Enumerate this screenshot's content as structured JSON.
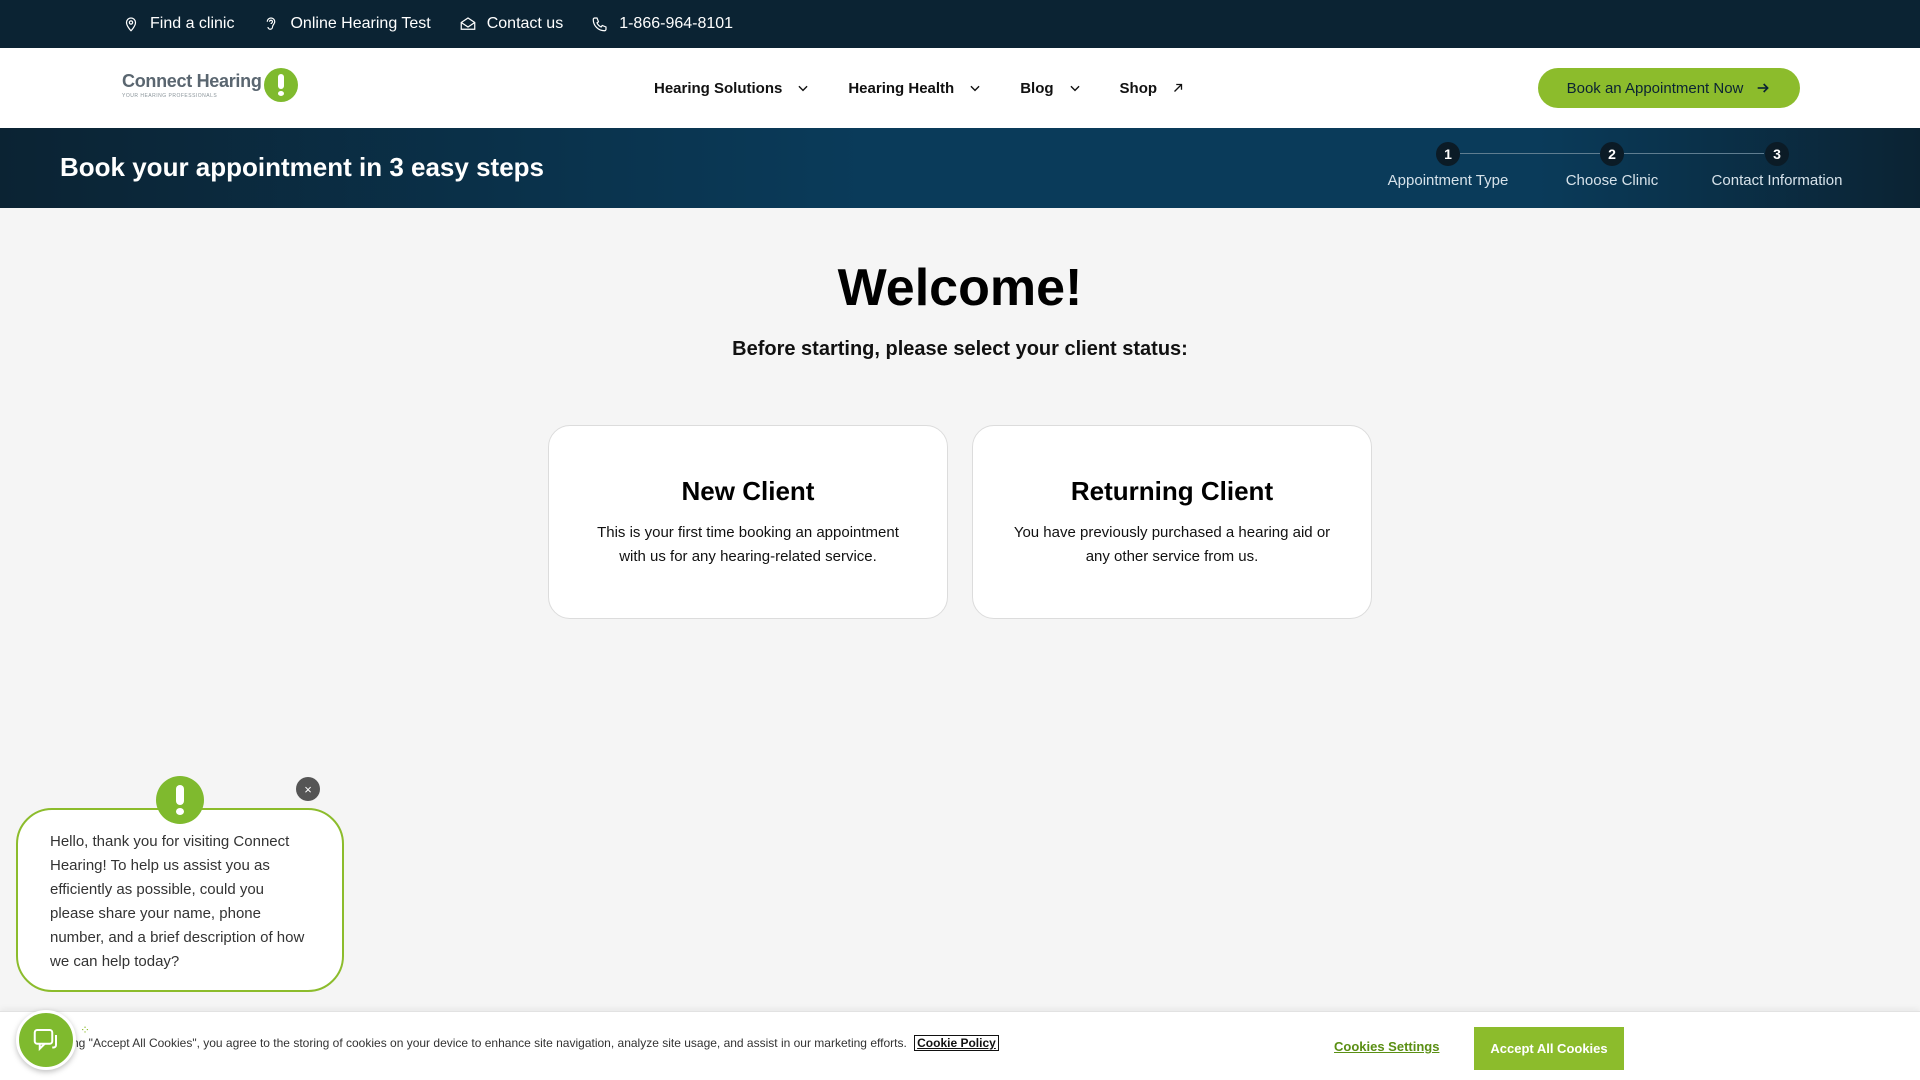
{
  "utility_bar": {
    "items": [
      {
        "label": "Find a clinic",
        "icon": "location-pin-icon"
      },
      {
        "label": "Online Hearing Test",
        "icon": "ear-icon"
      },
      {
        "label": "Contact us",
        "icon": "envelope-icon"
      },
      {
        "label": "1-866-964-8101",
        "icon": "phone-icon"
      }
    ]
  },
  "header": {
    "logo_name": "Connect Hearing",
    "logo_tagline": "YOUR HEARING PROFESSIONALS",
    "nav": [
      {
        "label": "Hearing Solutions",
        "icon": "chevron-down-icon"
      },
      {
        "label": "Hearing Health",
        "icon": "chevron-down-icon"
      },
      {
        "label": "Blog",
        "icon": "chevron-down-icon"
      },
      {
        "label": "Shop",
        "icon": "external-arrow-icon"
      }
    ],
    "cta_label": "Book an Appointment Now"
  },
  "banner": {
    "title": "Book your appointment in 3 easy steps",
    "steps": [
      {
        "num": "1",
        "label": "Appointment Type"
      },
      {
        "num": "2",
        "label": "Choose Clinic"
      },
      {
        "num": "3",
        "label": "Contact Information"
      }
    ]
  },
  "main": {
    "title": "Welcome!",
    "subtitle": "Before starting, please select your client status:",
    "cards": [
      {
        "title": "New Client",
        "desc": "This is your first time booking an appointment with us for any hearing-related service."
      },
      {
        "title": "Returning Client",
        "desc": "You have previously purchased a hearing aid or any other service from us."
      }
    ]
  },
  "chat": {
    "message": "Hello, thank you for visiting Connect Hearing! To help us assist you as efficiently as possible, could you please share your name, phone number, and a brief description of how we can help today?",
    "close_glyph": "×"
  },
  "cookie": {
    "text": "ng \"Accept All Cookies\", you agree to the storing of cookies on your device to enhance site navigation, analyze site usage, and assist in our marketing efforts.",
    "policy_link": "Cookie Policy",
    "settings_label": "Cookies Settings",
    "accept_label": "Accept All Cookies"
  },
  "colors": {
    "brand_green": "#8cbc2c",
    "navy": "#0b2333",
    "banner_blue": "#0a3b5a"
  }
}
